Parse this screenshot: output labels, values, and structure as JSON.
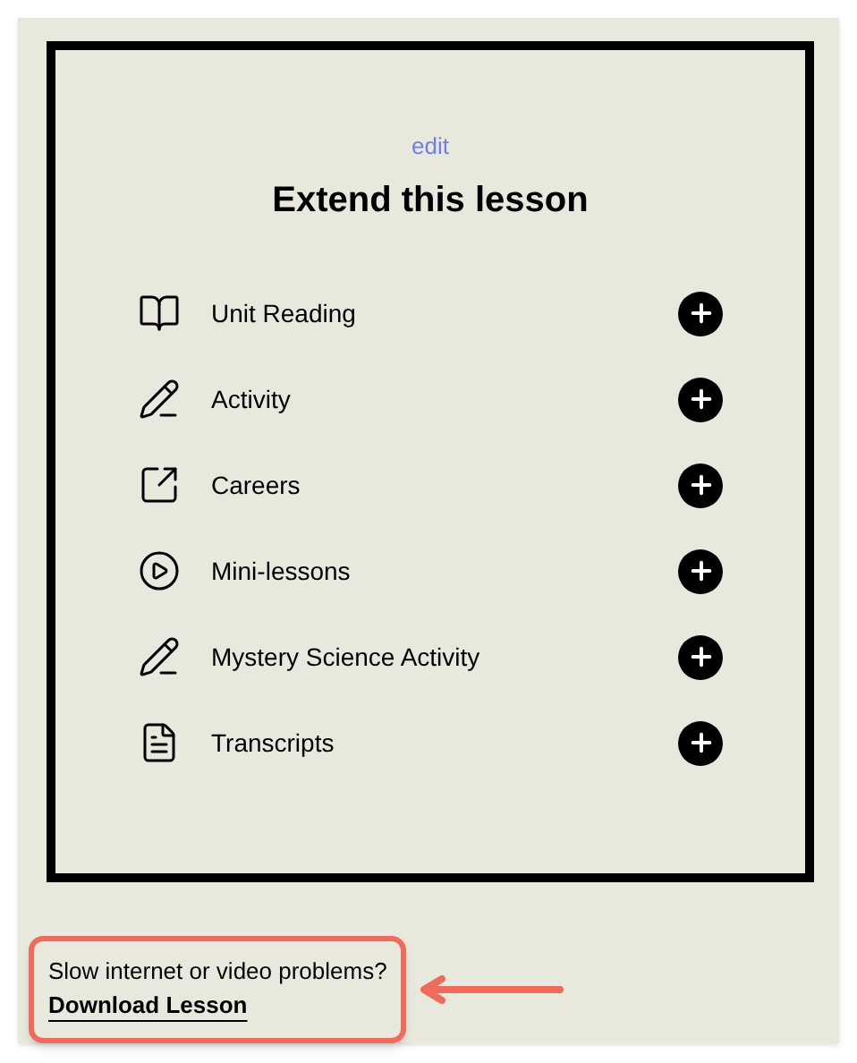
{
  "panel": {
    "edit_link": "edit",
    "title": "Extend this lesson",
    "items": [
      {
        "kind": "book",
        "label": "Unit Reading"
      },
      {
        "kind": "pencil",
        "label": "Activity"
      },
      {
        "kind": "external",
        "label": "Careers"
      },
      {
        "kind": "play",
        "label": "Mini-lessons"
      },
      {
        "kind": "pencil",
        "label": "Mystery Science Activity"
      },
      {
        "kind": "document",
        "label": "Transcripts"
      }
    ]
  },
  "footer": {
    "note": "Slow internet or video problems?",
    "link": "Download Lesson"
  }
}
